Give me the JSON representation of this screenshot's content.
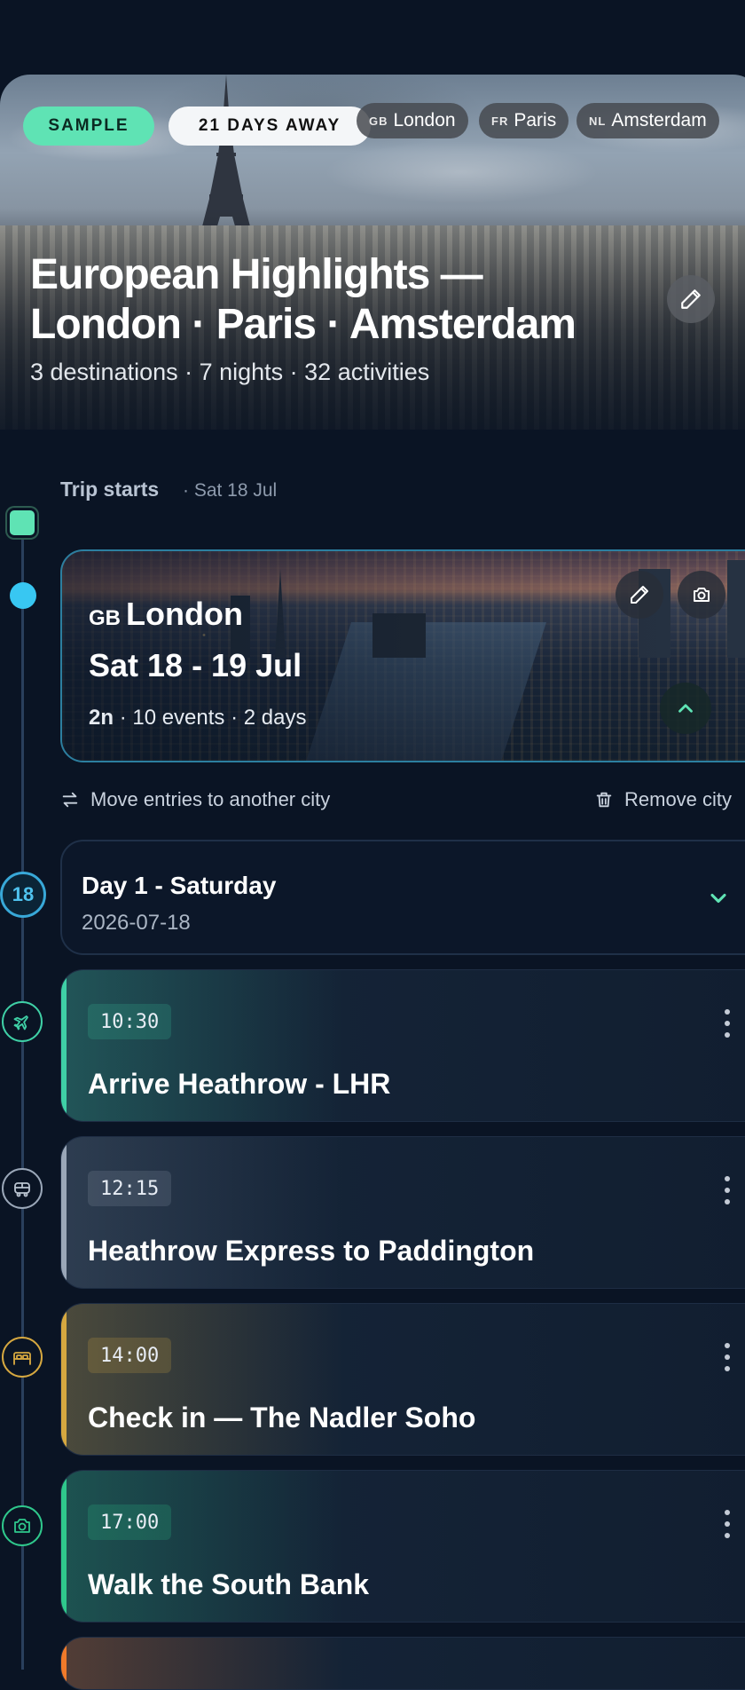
{
  "hero": {
    "sample_label": "SAMPLE",
    "days_away_label": "21 DAYS AWAY",
    "cities": [
      {
        "code": "GB",
        "name": "London"
      },
      {
        "code": "FR",
        "name": "Paris"
      },
      {
        "code": "NL",
        "name": "Amsterdam"
      }
    ],
    "title_line1": "European Highlights —",
    "title_line2": "London · Paris · Amsterdam",
    "subtitle": "3 destinations · 7 nights · 32 activities",
    "edit_icon": "pencil-icon"
  },
  "timeline": {
    "trip_starts_label": "Trip starts",
    "trip_starts_date": "· Sat 18 Jul"
  },
  "city_card": {
    "code": "GB",
    "name": "London",
    "dates": "Sat 18 - 19 Jul",
    "nights": "2n",
    "meta_rest": "· 10 events · 2 days",
    "icons": [
      "pencil-icon",
      "camera-icon",
      "chevron-up-icon"
    ],
    "border_color": "#2c7fa0"
  },
  "actions": {
    "move_label": "Move entries to another city",
    "remove_label": "Remove city"
  },
  "day": {
    "badge": "18",
    "title": "Day 1 - Saturday",
    "date": "2026-07-18"
  },
  "events": [
    {
      "time": "10:30",
      "name": "Arrive Heathrow - LHR",
      "icon": "plane-icon",
      "color": "#3fd0a6"
    },
    {
      "time": "12:15",
      "name": "Heathrow Express to Paddington",
      "icon": "train-icon",
      "color": "#9aa7b8"
    },
    {
      "time": "14:00",
      "name": "Check in — The Nadler Soho",
      "icon": "bed-icon",
      "color": "#d6a840"
    },
    {
      "time": "17:00",
      "name": "Walk the South Bank",
      "icon": "camera-icon",
      "color": "#2fc88c"
    }
  ],
  "colors": {
    "accent_green": "#5fe3b4",
    "accent_blue": "#38c7f2",
    "background": "#0a1424",
    "next_event_accent": "#f07a2a"
  }
}
